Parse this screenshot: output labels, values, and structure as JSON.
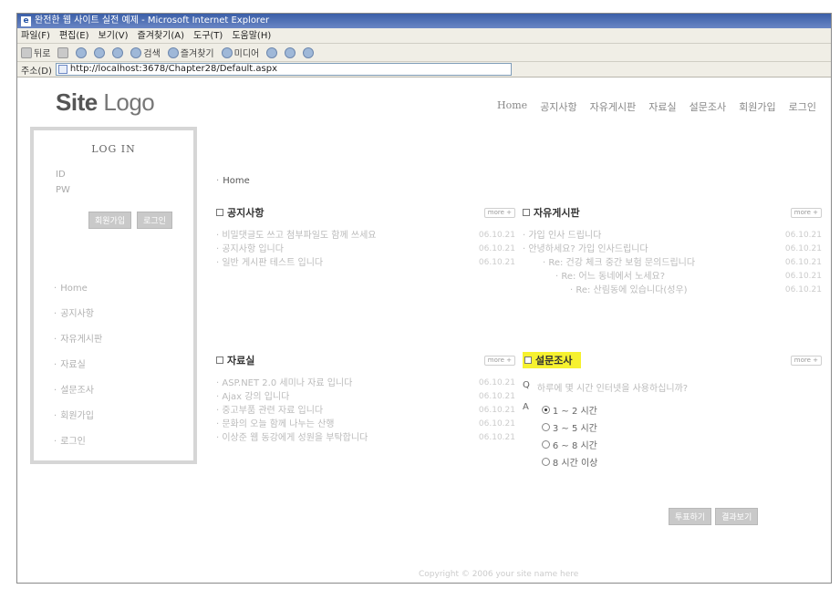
{
  "window": {
    "title": "완전한 웹 사이트 실전 예제 - Microsoft Internet Explorer",
    "menu": [
      "파일(F)",
      "편집(E)",
      "보기(V)",
      "즐겨찾기(A)",
      "도구(T)",
      "도움말(H)"
    ],
    "toolbar": {
      "back": "뒤로",
      "search": "검색",
      "favorites": "즐겨찾기",
      "media": "미디어"
    },
    "address_label": "주소(D)",
    "address_url": "http://localhost:3678/Chapter28/Default.aspx"
  },
  "site": {
    "logo_bold": "Site",
    "logo_rest": "Logo",
    "topnav": [
      "Home",
      "공지사항",
      "자유게시판",
      "자료실",
      "설문조사",
      "회원가입",
      "로그인"
    ]
  },
  "sidebar": {
    "login_title": "LOG IN",
    "id_label": "ID",
    "pw_label": "PW",
    "join_button": "회원가입",
    "login_button": "로그인",
    "menu": [
      "Home",
      "공지사항",
      "자유게시판",
      "자료실",
      "설문조사",
      "회원가입",
      "로그인"
    ]
  },
  "breadcrumb": "Home",
  "boards": {
    "notice": {
      "title": "공지사항",
      "more": "more +",
      "posts": [
        {
          "title": "비밀댓글도 쓰고 첨부파일도 함께 쓰세요",
          "date": "06.10.21"
        },
        {
          "title": "공지사항 입니다",
          "date": "06.10.21"
        },
        {
          "title": "일반 게시판 테스트 입니다",
          "date": "06.10.21"
        }
      ]
    },
    "free": {
      "title": "자유게시판",
      "more": "more +",
      "posts": [
        {
          "title": "가입 인사 드립니다",
          "date": "06.10.21"
        },
        {
          "title": "안녕하세요? 가입 인사드립니다",
          "date": "06.10.21"
        },
        {
          "title": "Re: 건강 체크 중간 보험 문의드립니다",
          "date": "06.10.21"
        },
        {
          "title": "Re: 어느 동네에서 노세요?",
          "date": "06.10.21"
        },
        {
          "title": "Re: 산림동에 있습니다(성우)",
          "date": "06.10.21"
        }
      ]
    },
    "data": {
      "title": "자료실",
      "more": "more +",
      "posts": [
        {
          "title": "ASP.NET 2.0 세미나 자료 입니다",
          "date": "06.10.21"
        },
        {
          "title": "Ajax 강의 입니다",
          "date": "06.10.21"
        },
        {
          "title": "중고부품 관련 자료 입니다",
          "date": "06.10.21"
        },
        {
          "title": "문화의 오늘 함께 나누는 산행",
          "date": "06.10.21"
        },
        {
          "title": "이상준 웹 동강에게 성원을 부탁합니다",
          "date": "06.10.21"
        }
      ]
    },
    "poll": {
      "title": "설문조사",
      "more": "more +",
      "q_label": "Q",
      "question": "하루에 몇 시간 인터넷을 사용하십니까?",
      "a_label": "A",
      "options": [
        "1 ~ 2 시간",
        "3 ~ 5 시간",
        "6 ~ 8 시간",
        "8 시간 이상"
      ],
      "selected_index": 0,
      "vote_button": "투표하기",
      "result_button": "결과보기"
    }
  },
  "copyright": "Copyright © 2006 your site name here",
  "colors": {
    "highlight": "#f6f12f",
    "title_bar": "#3b5fa8"
  }
}
